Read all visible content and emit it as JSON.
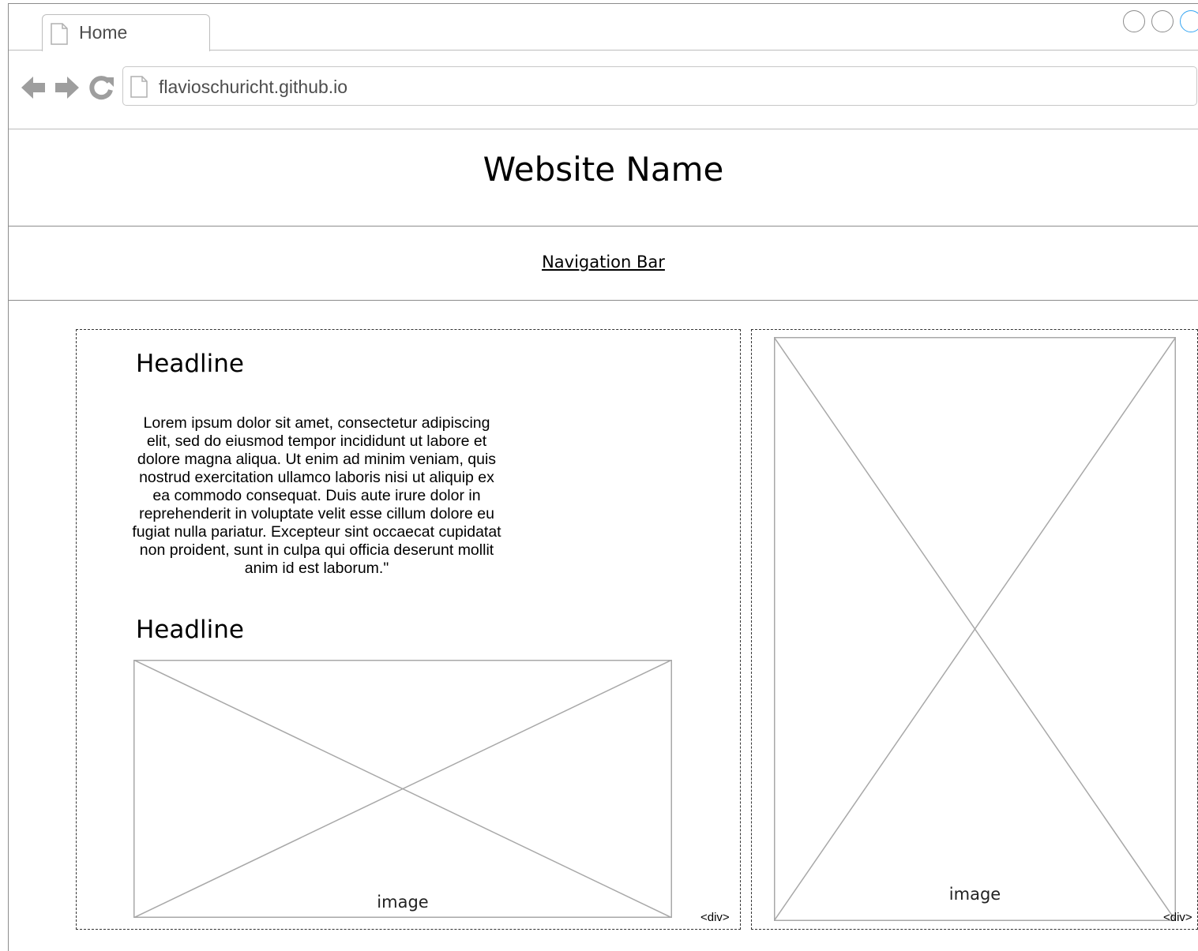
{
  "browser": {
    "tab_title": "Home",
    "address": "flavioschuricht.github.io",
    "accent_color": "#36a5f2"
  },
  "header": {
    "site_name": "Website Name"
  },
  "nav": {
    "label": "Navigation Bar"
  },
  "main": {
    "headline_1": "Headline",
    "body_text": "Lorem ipsum dolor sit amet, consectetur adipiscing elit, sed do eiusmod tempor incididunt ut labore et dolore magna aliqua. Ut enim ad minim veniam, quis nostrud exercitation ullamco laboris nisi ut aliquip ex ea commodo consequat. Duis aute irure dolor in reprehenderit in voluptate velit esse cillum dolore eu fugiat nulla pariatur. Excepteur sint occaecat cupidatat non proident, sunt in culpa qui officia deserunt mollit anim id est laborum.\"",
    "headline_2": "Headline",
    "image_label": "image",
    "div_tag": "<div>"
  },
  "sidebar": {
    "image_label": "image",
    "div_tag": "<div>"
  }
}
